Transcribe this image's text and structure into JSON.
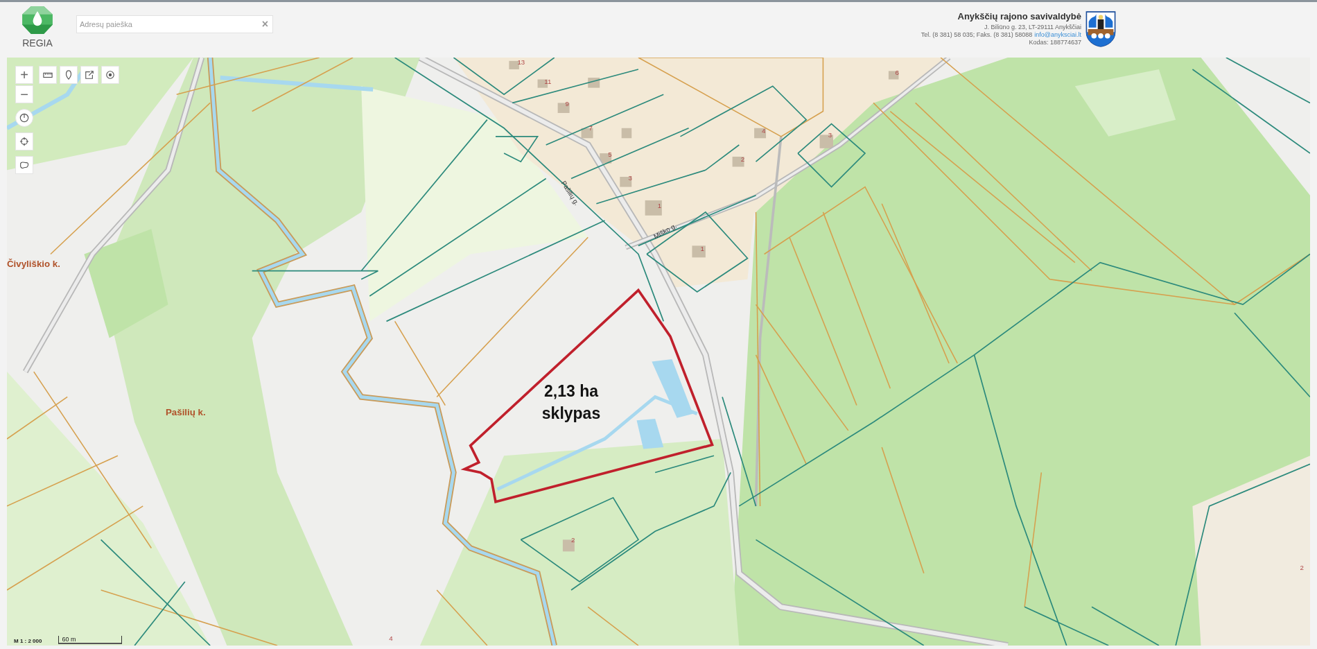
{
  "header": {
    "logo_text": "REGIA",
    "search": {
      "placeholder": "Adresų paieška",
      "clear": "×"
    },
    "municipality": {
      "name": "Anykščių rajono savivaldybė",
      "address": "J. Biliūno g. 23, LT-29111 Anykščiai",
      "phone": "Tel. (8 381) 58 035; Faks. (8 381) 58088",
      "email": "info@anyksciai.lt",
      "code": "Kodas: 188774637"
    }
  },
  "map": {
    "zoom_in": "+",
    "zoom_out": "−",
    "places": [
      "Čivyliškio k.",
      "Pašilių k."
    ],
    "streets": [
      "Pašilių g.",
      "Miško g."
    ],
    "house_numbers": [
      "13",
      "11",
      "9",
      "7",
      "5",
      "3",
      "1",
      "4",
      "2",
      "3",
      "1",
      "6",
      "2",
      "4",
      "2"
    ],
    "plot_label": [
      "2,13 ha",
      "sklypas"
    ],
    "scale": {
      "ratio": "M 1 : 2 000",
      "distance": "60 m"
    }
  }
}
